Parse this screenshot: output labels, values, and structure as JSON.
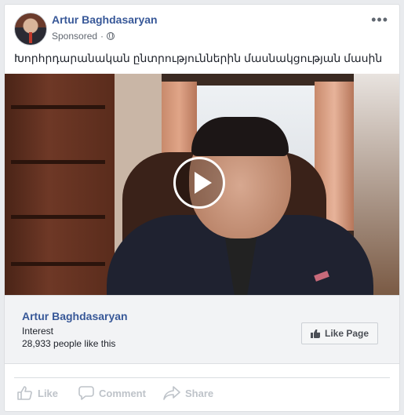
{
  "post": {
    "author": "Artur Baghdasaryan",
    "sponsored_label": "Sponsored",
    "separator": "·",
    "privacy_icon": "globe-icon",
    "more_icon": "more-options-icon",
    "more_glyph": "•••",
    "text": "Խորհրդարանական ընտրություններին մասնակցության մասին"
  },
  "video": {
    "play_icon": "play-icon"
  },
  "page_info": {
    "name": "Artur Baghdasaryan",
    "category": "Interest",
    "likes_text": "28,933 people like this",
    "like_page_label": "Like Page"
  },
  "actions": {
    "like": "Like",
    "comment": "Comment",
    "share": "Share"
  },
  "colors": {
    "link": "#385898",
    "muted": "#bec3c9",
    "background": "#e9ebee"
  }
}
